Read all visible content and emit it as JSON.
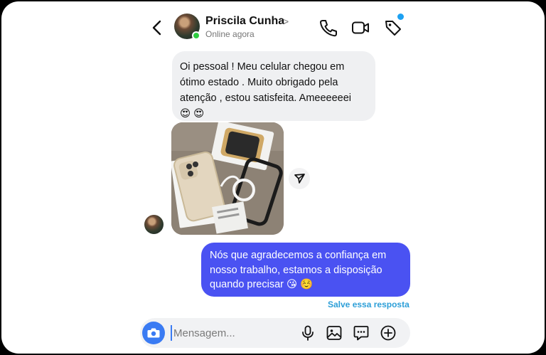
{
  "header": {
    "contact_name": "Priscila Cunha",
    "name_chevron": ">",
    "status": "Online agora",
    "icons": [
      "back-chevron-icon",
      "phone-icon",
      "video-camera-icon",
      "tag-icon"
    ],
    "badge_color": "#1da1f2",
    "online_color": "#2ecc40"
  },
  "messages": [
    {
      "direction": "incoming",
      "text": "Oi pessoal ! Meu celular chegou em ótimo estado . Muito obrigado pela atenção , estou satisfeita. Ameeeeeei",
      "emoji": "😍 😍"
    },
    {
      "direction": "incoming",
      "type": "photo"
    },
    {
      "direction": "outgoing",
      "text": "Nós que agradecemos a confiança em nosso trabalho, estamos a disposição quando precisar",
      "emoji": "😘 ☺️"
    }
  ],
  "save_reply_label": "Salve essa resposta",
  "composer": {
    "placeholder": "Mensagem...",
    "icons": [
      "camera-icon",
      "microphone-icon",
      "gallery-icon",
      "sticker-chat-icon",
      "plus-icon"
    ]
  },
  "colors": {
    "outgoing_bubble": "#4a52f2",
    "incoming_bubble": "#eff0f2",
    "camera_button": "#3a7bf3",
    "save_reply": "#2d9fd8"
  }
}
